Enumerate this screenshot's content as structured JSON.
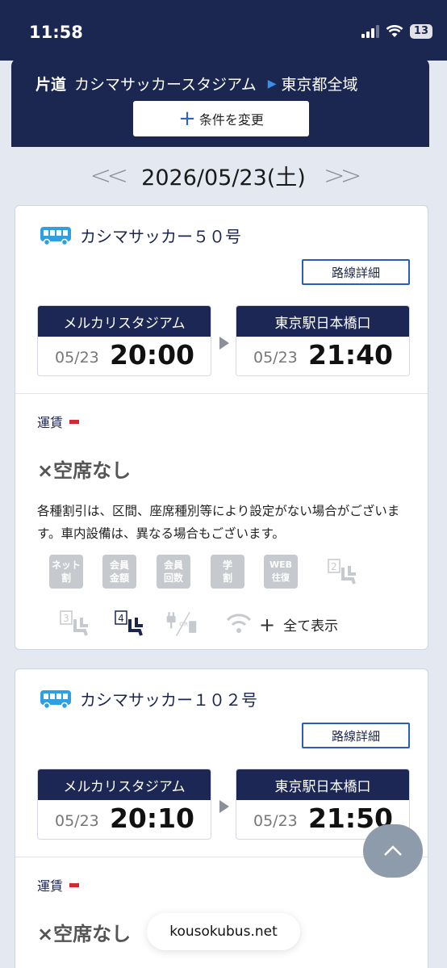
{
  "status_bar": {
    "time": "11:58",
    "battery": "13"
  },
  "header": {
    "trip_type": "片道",
    "from": "カシマサッカースタジアム",
    "to": "東京都全域",
    "change_button": "条件を変更"
  },
  "date_nav": {
    "prev": "<<",
    "date": "2026/05/23(土)",
    "next": ">>"
  },
  "buses": [
    {
      "name": "カシマサッカー５０号",
      "detail_button": "路線詳細",
      "departure": {
        "stop": "メルカリスタジアム",
        "date": "05/23",
        "time": "20:00"
      },
      "arrival": {
        "stop": "東京駅日本橋口",
        "date": "05/23",
        "time": "21:40"
      },
      "fare_label": "運賃",
      "availability": "×空席なし",
      "note": "各種割引は、区間、座席種別等により設定がない場合がございます。車内設備は、異なる場合もございます。",
      "tags": [
        {
          "l1": "ネット",
          "l2": "割"
        },
        {
          "l1": "会員",
          "l2": "金額"
        },
        {
          "l1": "会員",
          "l2": "回数"
        },
        {
          "l1": "学",
          "l2": "割"
        },
        {
          "l1": "WEB",
          "l2": "往復"
        }
      ],
      "seat_labels": [
        "2",
        "3",
        "4"
      ],
      "power_or": "OR",
      "show_all": "全て表示"
    },
    {
      "name": "カシマサッカー１０２号",
      "detail_button": "路線詳細",
      "departure": {
        "stop": "メルカリスタジアム",
        "date": "05/23",
        "time": "20:10"
      },
      "arrival": {
        "stop": "東京駅日本橋口",
        "date": "05/23",
        "time": "21:50"
      },
      "fare_label": "運賃",
      "availability": "×空席なし"
    }
  ],
  "url": "kousokubus.net",
  "colors": {
    "navy": "#1b2651",
    "accent_blue": "#2a5bbf",
    "fare_red": "#d9272e",
    "bus_icon": "#2e9fe0"
  }
}
